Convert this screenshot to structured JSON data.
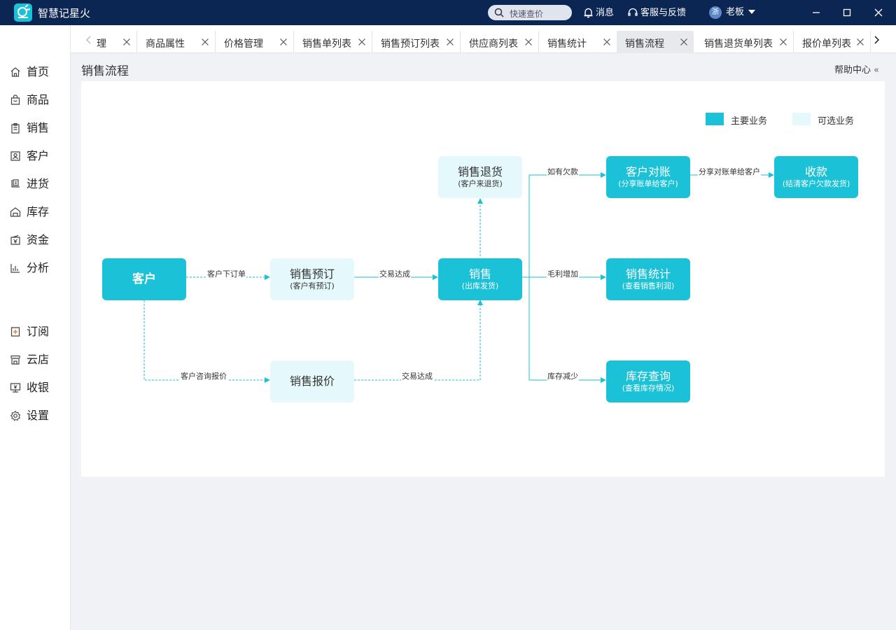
{
  "app": {
    "title": "智慧记星火",
    "search_placeholder": "快速查价",
    "messages_label": "消息",
    "service_label": "客服与反馈",
    "user": {
      "avatar_text": "浙",
      "name": "老板"
    }
  },
  "sidebar": {
    "items": [
      {
        "label": "首页",
        "icon": "home-icon"
      },
      {
        "label": "商品",
        "icon": "product-bag-icon"
      },
      {
        "label": "销售",
        "icon": "sales-clipboard-icon"
      },
      {
        "label": "客户",
        "icon": "customer-card-icon"
      },
      {
        "label": "进货",
        "icon": "purchase-icon"
      },
      {
        "label": "库存",
        "icon": "warehouse-icon"
      },
      {
        "label": "资金",
        "icon": "funds-icon"
      },
      {
        "label": "分析",
        "icon": "analysis-chart-icon"
      },
      {
        "label": "订阅",
        "icon": "subscribe-icon"
      },
      {
        "label": "云店",
        "icon": "cloud-store-icon"
      },
      {
        "label": "收银",
        "icon": "cashier-icon"
      },
      {
        "label": "设置",
        "icon": "settings-gear-icon"
      }
    ]
  },
  "tabs": {
    "items": [
      {
        "label": "理",
        "active": false
      },
      {
        "label": "商品属性",
        "active": false
      },
      {
        "label": "价格管理",
        "active": false
      },
      {
        "label": "销售单列表",
        "active": false
      },
      {
        "label": "销售预订列表",
        "active": false
      },
      {
        "label": "供应商列表",
        "active": false
      },
      {
        "label": "销售统计",
        "active": false
      },
      {
        "label": "销售流程",
        "active": true
      },
      {
        "label": "销售退货单列表",
        "active": false
      },
      {
        "label": "报价单列表",
        "active": false
      }
    ]
  },
  "page": {
    "title": "销售流程",
    "help_label": "帮助中心",
    "help_arrow": "«"
  },
  "legend": {
    "main": {
      "label": "主要业务",
      "color": "#1bc1d6"
    },
    "optional": {
      "label": "可选业务",
      "color": "#e5f9fc"
    }
  },
  "flow": {
    "nodes": {
      "customer": {
        "title": "客户",
        "sub": ""
      },
      "presale": {
        "title": "销售预订",
        "sub": "(客户有预订)"
      },
      "quote": {
        "title": "销售报价",
        "sub": ""
      },
      "sale": {
        "title": "销售",
        "sub": "(出库发货)"
      },
      "return": {
        "title": "销售退货",
        "sub": "(客户来退货)"
      },
      "reconcile": {
        "title": "客户对账",
        "sub": "(分享账单给客户)"
      },
      "collect": {
        "title": "收款",
        "sub": "(结清客户欠款发货)"
      },
      "stats": {
        "title": "销售统计",
        "sub": "(查看销售利润)"
      },
      "stock": {
        "title": "库存查询",
        "sub": "(查看库存情况)"
      }
    },
    "edges": {
      "order": "客户下订单",
      "deal1": "交易达成",
      "inquiry": "客户咨询报价",
      "deal2": "交易达成",
      "debt": "如有欠款",
      "share": "分享对账单给客户",
      "profit": "毛利增加",
      "stock_down": "库存减少"
    },
    "colors": {
      "line": "#1bc1d6",
      "arrow": "#1bc1d6"
    }
  }
}
